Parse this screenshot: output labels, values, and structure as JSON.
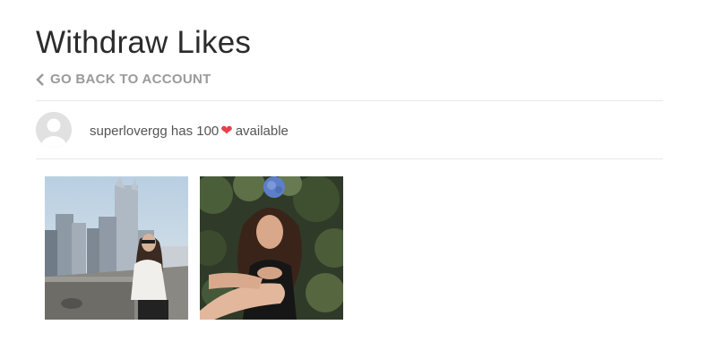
{
  "page": {
    "title": "Withdraw Likes",
    "back_link": "GO BACK TO ACCOUNT"
  },
  "user": {
    "username": "superlovergg",
    "has_text": "has",
    "likes": "100",
    "available_text": "available",
    "heart_icon": "heart-icon",
    "heart_color": "#e8414b"
  },
  "photos": [
    {
      "icon": "city-photo"
    },
    {
      "icon": "portrait-photo"
    }
  ]
}
